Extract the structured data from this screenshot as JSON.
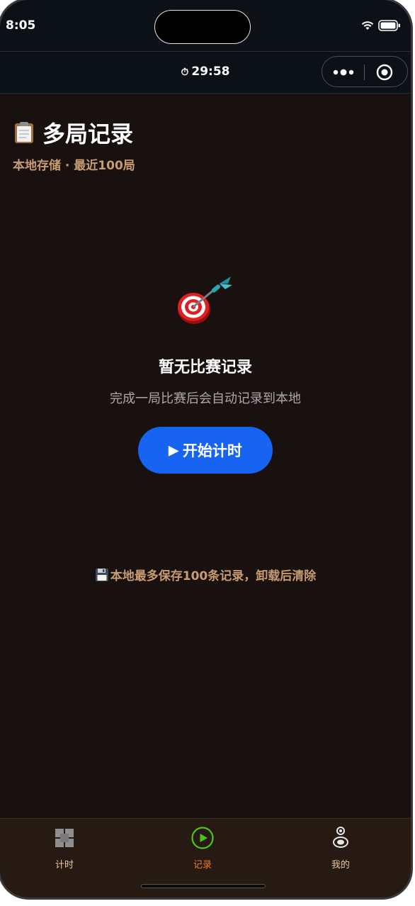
{
  "status_bar": {
    "time": "8:05"
  },
  "navbar": {
    "timer_icon": "⏱",
    "timer": "29:58"
  },
  "header": {
    "icon": "clipboard-icon",
    "title": "多局记录",
    "subtitle": "本地存储 · 最近100局"
  },
  "empty_state": {
    "icon": "dart-target-icon",
    "title": "暂无比赛记录",
    "description": "完成一局比赛后会自动记录到本地",
    "button_label": "开始计时",
    "button_icon": "▶"
  },
  "footnote": {
    "icon": "floppy-disk-icon",
    "text": "本地最多保存100条记录，卸载后清除"
  },
  "tabbar": {
    "items": [
      {
        "label": "计时",
        "icon": "grid-icon",
        "active": false
      },
      {
        "label": "记录",
        "icon": "play-circle-icon",
        "active": true
      },
      {
        "label": "我的",
        "icon": "user-icon",
        "active": false
      }
    ]
  },
  "colors": {
    "background": "#181110",
    "accent_blue": "#1764f3",
    "subtitle_tan": "#c89b70",
    "tab_active": "#f07a22",
    "tab_active_icon": "#4cc51c",
    "tab_inactive": "#e8c9a3"
  }
}
